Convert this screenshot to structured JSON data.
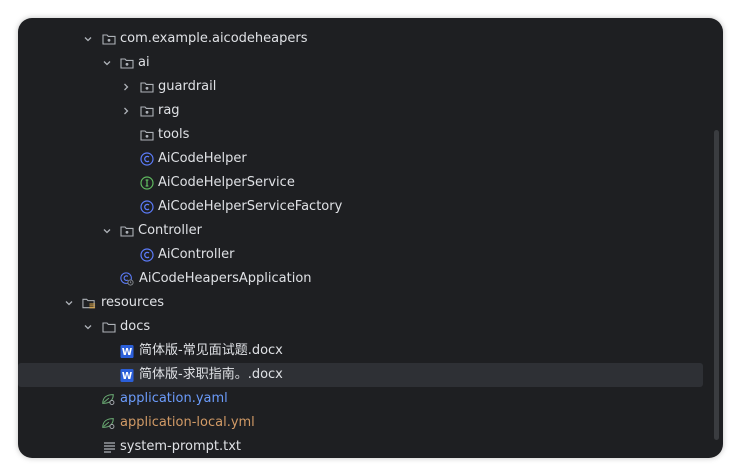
{
  "tree": {
    "package_root": "com.example.aicodeheapers",
    "ai_folder": "ai",
    "guardrail_folder": "guardrail",
    "rag_folder": "rag",
    "tools_folder": "tools",
    "class_helper": "AiCodeHelper",
    "interface_service": "AiCodeHelperService",
    "class_factory": "AiCodeHelperServiceFactory",
    "controller_folder": "Controller",
    "class_controller": "AiController",
    "class_application": "AiCodeHeapersApplication",
    "resources_folder": "resources",
    "docs_folder": "docs",
    "doc_file_1": "简体版-常见面试题.docx",
    "doc_file_2": "简体版-求职指南。.docx",
    "yaml_file": "application.yaml",
    "yml_local_file": "application-local.yml",
    "txt_file": "system-prompt.txt"
  },
  "colors": {
    "panel_bg": "#1e1f22",
    "text": "#dfe1e5",
    "class_icon": "#5c7cfa",
    "interface_icon": "#5fb85f",
    "yaml_blue": "#6b9bfa",
    "yaml_orange": "#d19a66",
    "word_icon": "#2b5fd9"
  }
}
